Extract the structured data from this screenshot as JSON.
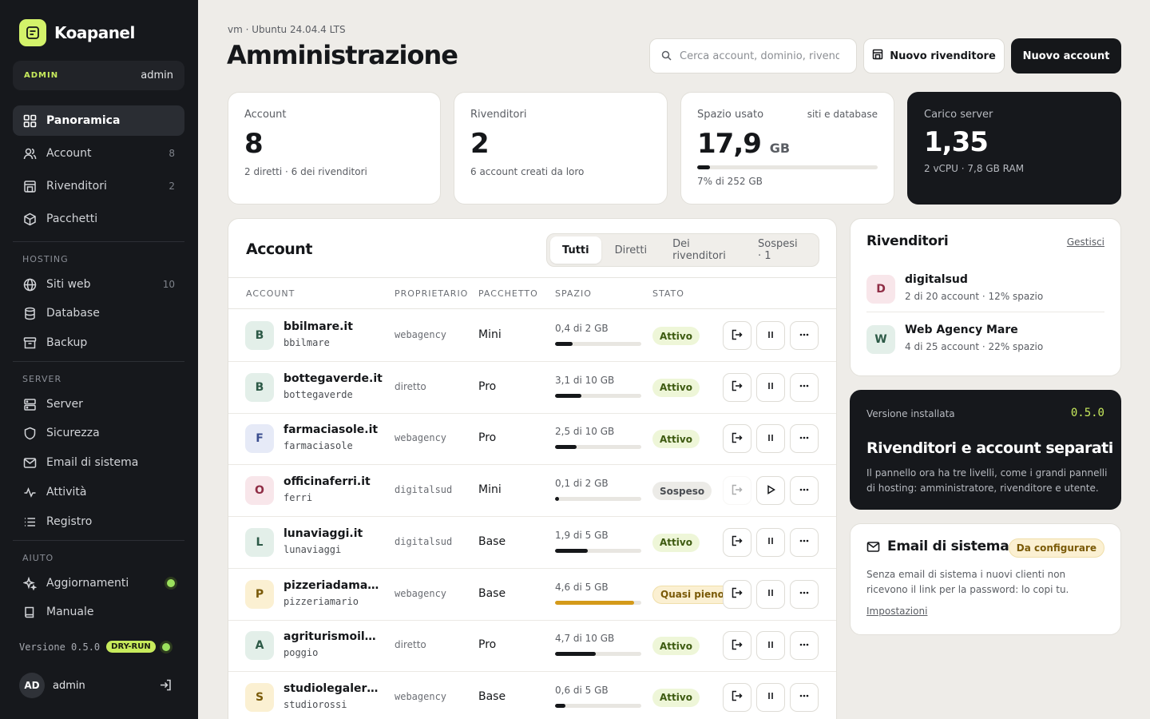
{
  "app": {
    "name": "Koapanel"
  },
  "role": {
    "badge": "ADMIN",
    "user": "admin"
  },
  "nav": {
    "main": [
      {
        "label": "Panoramica",
        "icon": "grid-icon",
        "count": ""
      },
      {
        "label": "Account",
        "icon": "users-icon",
        "count": "8"
      },
      {
        "label": "Rivenditori",
        "icon": "store-icon",
        "count": "2"
      },
      {
        "label": "Pacchetti",
        "icon": "box-icon",
        "count": ""
      }
    ],
    "hosting_label": "HOSTING",
    "hosting": [
      {
        "label": "Siti web",
        "icon": "globe-icon",
        "count": "10"
      },
      {
        "label": "Database",
        "icon": "database-icon",
        "count": ""
      },
      {
        "label": "Backup",
        "icon": "archive-icon",
        "count": ""
      }
    ],
    "server_label": "SERVER",
    "server": [
      {
        "label": "Server",
        "icon": "server-icon"
      },
      {
        "label": "Sicurezza",
        "icon": "shield-icon"
      },
      {
        "label": "Email di sistema",
        "icon": "mail-icon"
      },
      {
        "label": "Attività",
        "icon": "activity-icon"
      },
      {
        "label": "Registro",
        "icon": "list-icon"
      }
    ],
    "help_label": "AIUTO",
    "help": [
      {
        "label": "Aggiornamenti",
        "icon": "sparkle-icon"
      },
      {
        "label": "Manuale",
        "icon": "book-icon"
      }
    ]
  },
  "footer": {
    "version": "Versione 0.5.0",
    "mode": "DRY-RUN",
    "avatar": "AD",
    "user": "admin"
  },
  "header": {
    "subtitle": "vm · Ubuntu 24.04.4 LTS",
    "title": "Amministrazione",
    "search_placeholder": "Cerca account, dominio, rivenditore…",
    "btn_reseller": "Nuovo rivenditore",
    "btn_account": "Nuovo account"
  },
  "stats": {
    "accounts": {
      "label": "Account",
      "value": "8",
      "note": "2 diretti · 6 dei rivenditori"
    },
    "resellers": {
      "label": "Rivenditori",
      "value": "2",
      "note": "6 account creati da loro"
    },
    "storage": {
      "label": "Spazio usato",
      "aside": "siti e database",
      "value": "17,9",
      "unit": "GB",
      "note": "7% di 252 GB",
      "percent": 7
    },
    "load": {
      "label": "Carico server",
      "value": "1,35",
      "note": "2 vCPU · 7,8 GB RAM"
    }
  },
  "accounts": {
    "title": "Account",
    "tabs": [
      "Tutti",
      "Diretti",
      "Dei rivenditori",
      "Sospesi · 1"
    ],
    "columns": [
      "ACCOUNT",
      "PROPRIETARIO",
      "PACCHETTO",
      "SPAZIO",
      "STATO"
    ],
    "rows": [
      {
        "letter": "B",
        "domain": "bbilmare.it",
        "user": "bbilmare",
        "owner": "webagency",
        "package": "Mini",
        "space": "0,4 di 2 GB",
        "usage": 0.2,
        "status": "Attivo",
        "kind": "ok",
        "color": "#e3efe9",
        "fg": "#2d5a47"
      },
      {
        "letter": "B",
        "domain": "bottegaverde.it",
        "user": "bottegaverde",
        "owner": "diretto",
        "package": "Pro",
        "space": "3,1 di 10 GB",
        "usage": 0.31,
        "status": "Attivo",
        "kind": "ok",
        "color": "#e3efe9",
        "fg": "#2d5a47"
      },
      {
        "letter": "F",
        "domain": "farmaciasole.it",
        "user": "farmaciasole",
        "owner": "webagency",
        "package": "Pro",
        "space": "2,5 di 10 GB",
        "usage": 0.25,
        "status": "Attivo",
        "kind": "ok",
        "color": "#e6eaf7",
        "fg": "#3a4d8f"
      },
      {
        "letter": "O",
        "domain": "officinaferri.it",
        "user": "ferri",
        "owner": "digitalsud",
        "package": "Mini",
        "space": "0,1 di 2 GB",
        "usage": 0.05,
        "status": "Sospeso",
        "kind": "susp",
        "color": "#f8e6ea",
        "fg": "#8f2d45"
      },
      {
        "letter": "L",
        "domain": "lunaviaggi.it",
        "user": "lunaviaggi",
        "owner": "digitalsud",
        "package": "Base",
        "space": "1,9 di 5 GB",
        "usage": 0.38,
        "status": "Attivo",
        "kind": "ok",
        "color": "#e3efe9",
        "fg": "#2d5a47"
      },
      {
        "letter": "P",
        "domain": "pizzeriadamario.it",
        "user": "pizzeriamario",
        "owner": "webagency",
        "package": "Base",
        "space": "4,6 di 5 GB",
        "usage": 0.92,
        "status": "Quasi pieno",
        "kind": "warn",
        "color": "#fbf0d2",
        "fg": "#7a5a08"
      },
      {
        "letter": "A",
        "domain": "agriturismoilpoggio.it",
        "user": "poggio",
        "owner": "diretto",
        "package": "Pro",
        "space": "4,7 di 10 GB",
        "usage": 0.47,
        "status": "Attivo",
        "kind": "ok",
        "color": "#e3efe9",
        "fg": "#2d5a47"
      },
      {
        "letter": "S",
        "domain": "studiolegalerossi.it",
        "user": "studiorossi",
        "owner": "webagency",
        "package": "Base",
        "space": "0,6 di 5 GB",
        "usage": 0.12,
        "status": "Attivo",
        "kind": "ok",
        "color": "#fbf0d2",
        "fg": "#7a5a08"
      }
    ]
  },
  "resellers": {
    "title": "Rivenditori",
    "manage": "Gestisci",
    "items": [
      {
        "letter": "D",
        "name": "digitalsud",
        "meta": "2 di 20 account · 12% spazio",
        "color": "#f8e6ea",
        "fg": "#8f2d45"
      },
      {
        "letter": "W",
        "name": "Web Agency Mare",
        "meta": "4 di 25 account · 22% spazio",
        "color": "#e3efe9",
        "fg": "#2d5a47"
      }
    ]
  },
  "release": {
    "label": "Versione installata",
    "version": "0.5.0",
    "title": "Rivenditori e account separati",
    "text": "Il pannello ora ha tre livelli, come i grandi pannelli di hosting: amministratore, rivenditore e utente."
  },
  "email": {
    "title": "Email di sistema",
    "badge": "Da configurare",
    "text": "Senza email di sistema i nuovi clienti non ricevono il link per la password: lo copi tu.",
    "link": "Impostazioni"
  }
}
